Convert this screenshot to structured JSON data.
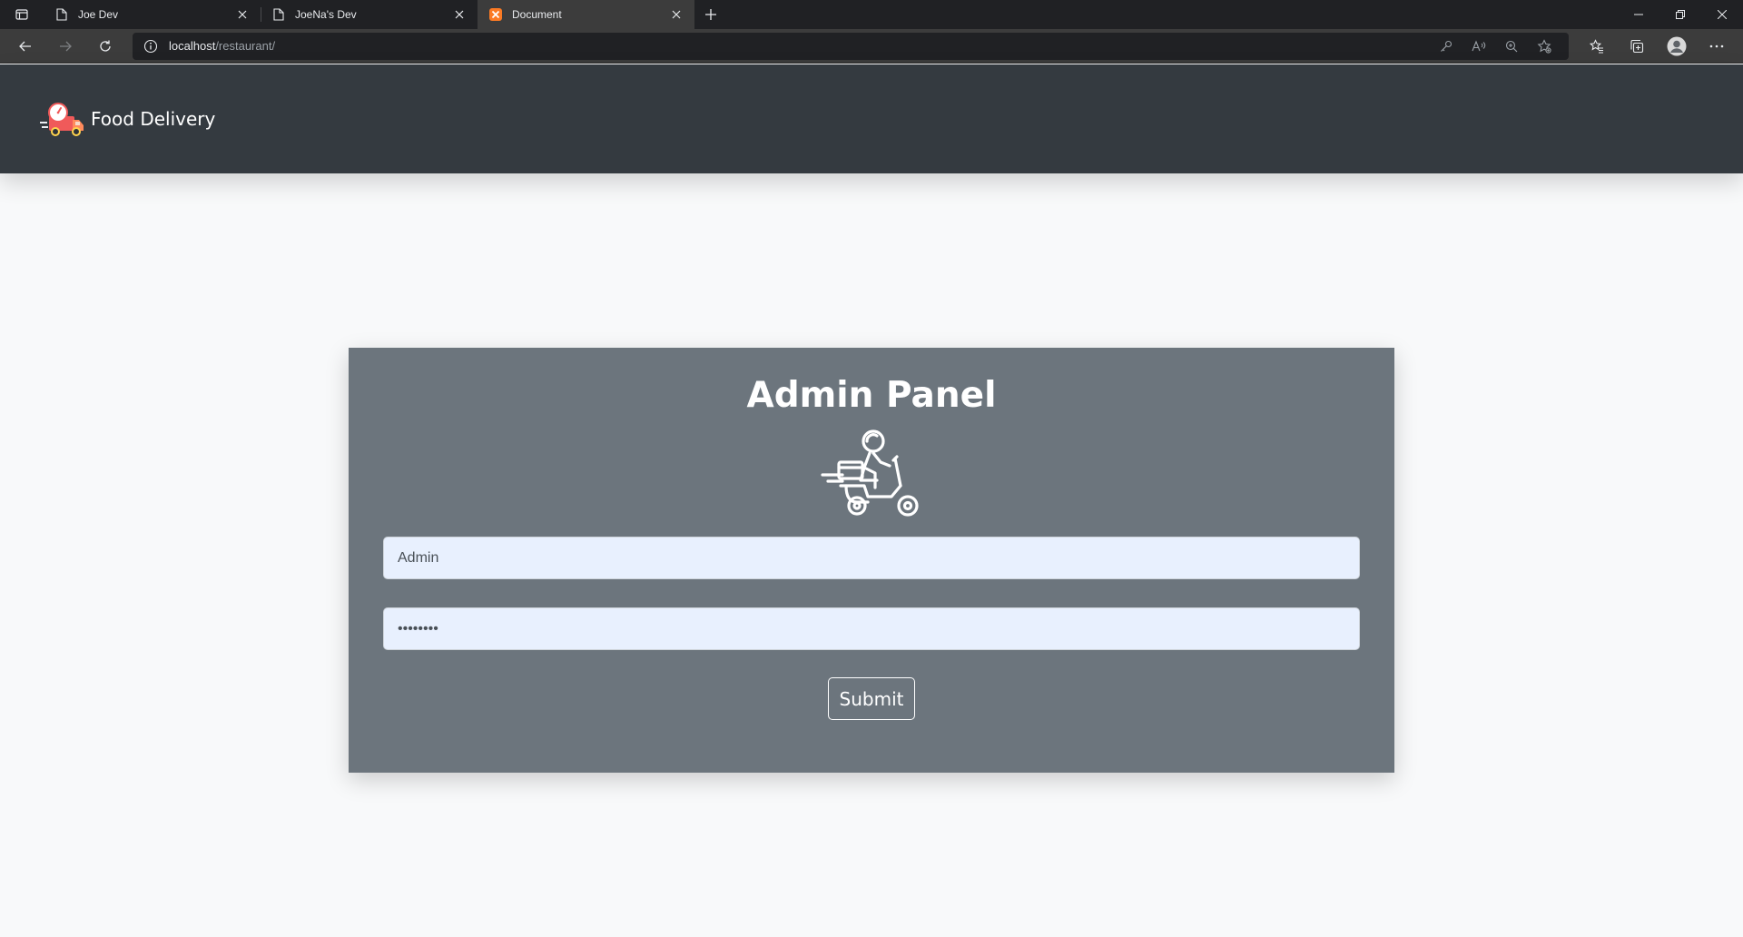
{
  "browser": {
    "tabs": [
      {
        "title": "Joe Dev",
        "icon": "page-icon",
        "active": false
      },
      {
        "title": "JoeNa's Dev",
        "icon": "page-icon",
        "active": false
      },
      {
        "title": "Document",
        "icon": "xampp-icon",
        "active": true
      }
    ],
    "address": {
      "host": "localhost",
      "path": "/restaurant/"
    }
  },
  "navbar": {
    "brand": "Food Delivery",
    "logo_icon": "delivery-truck-icon"
  },
  "panel": {
    "title": "Admin Panel",
    "illustration": "scooter-rider-icon",
    "username_value": "Admin",
    "password_value": "••••••••",
    "submit_label": "Submit"
  },
  "colors": {
    "navbar_bg": "#343a40",
    "panel_bg": "#6c757d",
    "input_bg": "#e8f0fe",
    "page_bg": "#f8f9fa"
  }
}
